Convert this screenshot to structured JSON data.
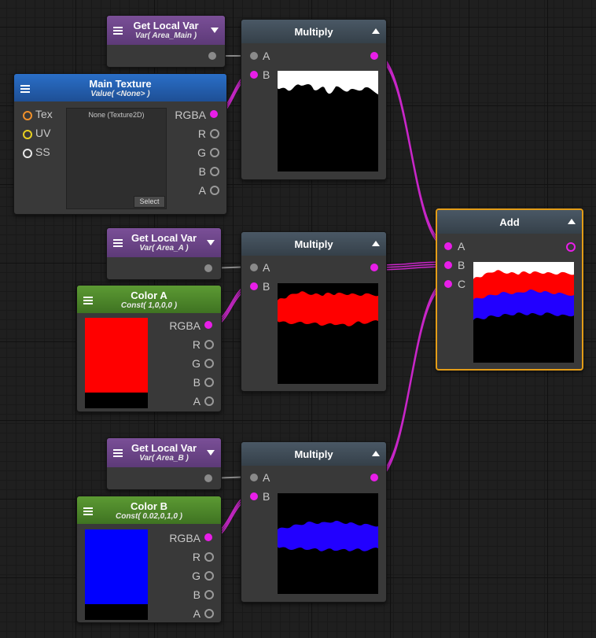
{
  "nodes": {
    "var_main": {
      "title": "Get Local Var",
      "subtitle": "Var( Area_Main )"
    },
    "var_a": {
      "title": "Get Local Var",
      "subtitle": "Var( Area_A )"
    },
    "var_b": {
      "title": "Get Local Var",
      "subtitle": "Var( Area_B )"
    },
    "main_texture": {
      "title": "Main Texture",
      "subtitle": "Value( <None> )",
      "inputs": [
        "Tex",
        "UV",
        "SS"
      ],
      "outputs": [
        "RGBA",
        "R",
        "G",
        "B",
        "A"
      ],
      "texture_label": "None (Texture2D)",
      "select_label": "Select"
    },
    "color_a": {
      "title": "Color A",
      "subtitle": "Const( 1,0,0,0 )",
      "swatch": "#ff0000",
      "outputs": [
        "RGBA",
        "R",
        "G",
        "B",
        "A"
      ]
    },
    "color_b": {
      "title": "Color B",
      "subtitle": "Const( 0.02,0,1,0 )",
      "swatch": "#0000ff",
      "outputs": [
        "RGBA",
        "R",
        "G",
        "B",
        "A"
      ]
    },
    "multiply_1": {
      "title": "Multiply",
      "inputs": [
        "A",
        "B"
      ]
    },
    "multiply_2": {
      "title": "Multiply",
      "inputs": [
        "A",
        "B"
      ]
    },
    "multiply_3": {
      "title": "Multiply",
      "inputs": [
        "A",
        "B"
      ]
    },
    "add": {
      "title": "Add",
      "inputs": [
        "A",
        "B",
        "C"
      ]
    }
  },
  "colors": {
    "wire": "#e81ee8",
    "selection": "#e39c17",
    "red": "#ff0000",
    "blue": "#2200ff"
  }
}
